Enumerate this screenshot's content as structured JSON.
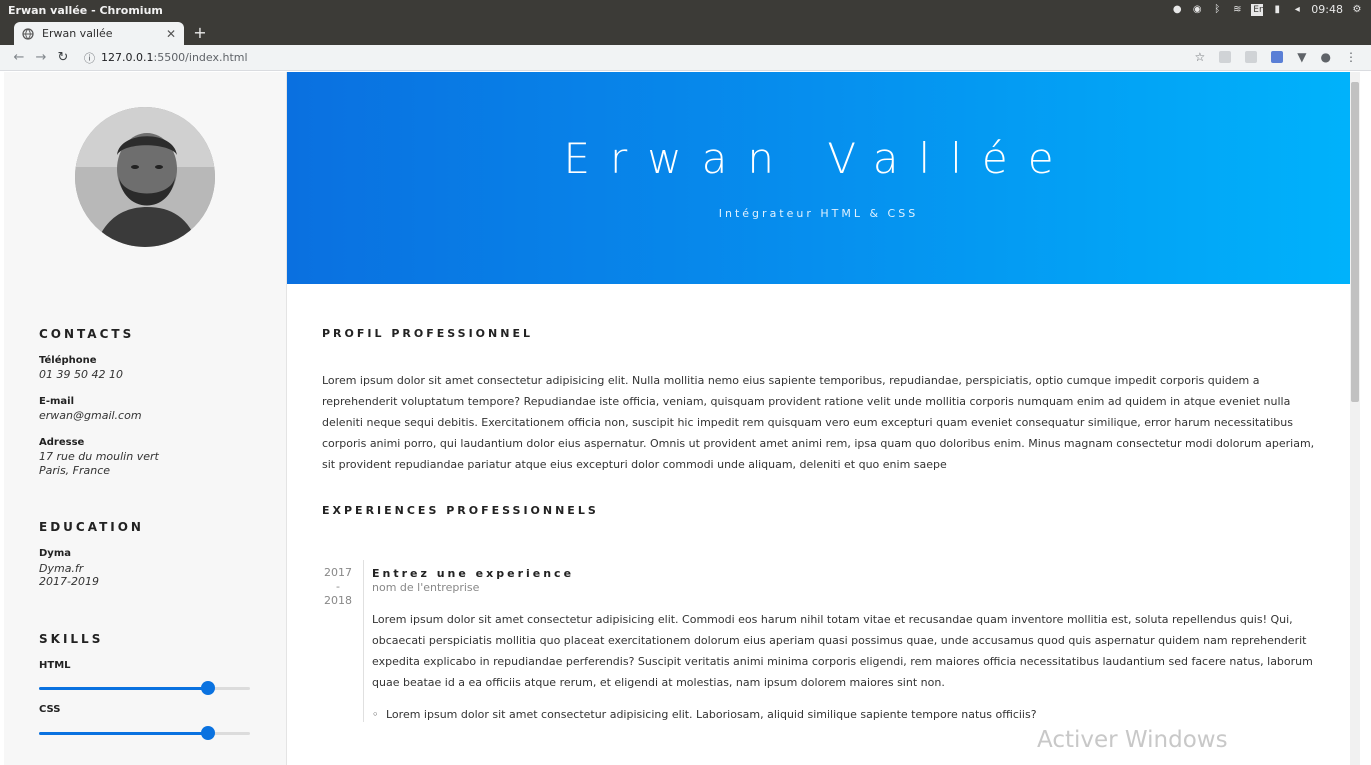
{
  "os": {
    "window_title": "Erwan vallée - Chromium",
    "clock": "09:48",
    "lang": "En"
  },
  "browser": {
    "tab_title": "Erwan vallée",
    "new_tab": "+",
    "url_host": "127.0.0.1",
    "url_rest": ":5500/index.html"
  },
  "sidebar": {
    "contacts_heading": "CONTACTS",
    "phone_label": "Téléphone",
    "phone_value": "01 39 50 42 10",
    "email_label": "E-mail",
    "email_value": "erwan@gmail.com",
    "address_label": "Adresse",
    "address_line1": "17 rue du moulin vert",
    "address_line2": "Paris, France",
    "education_heading": "EDUCATION",
    "school_name": "Dyma",
    "school_site": "Dyma.fr",
    "school_years": "2017-2019",
    "skills_heading": "SKILLS",
    "skills": [
      {
        "name": "HTML",
        "level": 0.8
      },
      {
        "name": "CSS",
        "level": 0.8
      }
    ]
  },
  "hero": {
    "name": "Erwan Vallée",
    "title": "Intégrateur HTML & CSS"
  },
  "main": {
    "profile_heading": "PROFIL PROFESSIONNEL",
    "profile_text": "Lorem ipsum dolor sit amet consectetur adipisicing elit. Nulla mollitia nemo eius sapiente temporibus, repudiandae, perspiciatis, optio cumque impedit corporis quidem a reprehenderit voluptatum tempore? Repudiandae iste officia, veniam, quisquam provident ratione velit unde mollitia corporis numquam enim ad quidem in atque eveniet nulla deleniti neque sequi debitis. Exercitationem officia non, suscipit hic impedit rem quisquam vero eum excepturi quam eveniet consequatur similique, error harum necessitatibus corporis animi porro, qui laudantium dolor eius aspernatur. Omnis ut provident amet animi rem, ipsa quam quo doloribus enim. Minus magnam consectetur modi dolorum aperiam, sit provident repudiandae pariatur atque eius excepturi dolor commodi unde aliquam, deleniti et quo enim saepe",
    "experience_heading": "EXPERIENCES PROFESSIONNELS",
    "experience": {
      "year_start": "2017",
      "year_sep": "-",
      "year_end": "2018",
      "title": "Entrez une experience",
      "company": "nom de l'entreprise",
      "description": "Lorem ipsum dolor sit amet consectetur adipisicing elit. Commodi eos harum nihil totam vitae et recusandae quam inventore mollitia est, soluta repellendus quis! Qui, obcaecati perspiciatis mollitia quo placeat exercitationem dolorum eius aperiam quasi possimus quae, unde accusamus quod quis aspernatur quidem nam reprehenderit expedita explicabo in repudiandae perferendis? Suscipit veritatis animi minima corporis eligendi, rem maiores officia necessitatibus laudantium sed facere natus, laborum quae beatae id a ea officiis atque rerum, et eligendi at molestias, nam ipsum dolorem maiores sint non.",
      "bullet": "Lorem ipsum dolor sit amet consectetur adipisicing elit. Laboriosam, aliquid similique sapiente tempore natus officiis?"
    }
  },
  "watermark": "Activer Windows"
}
